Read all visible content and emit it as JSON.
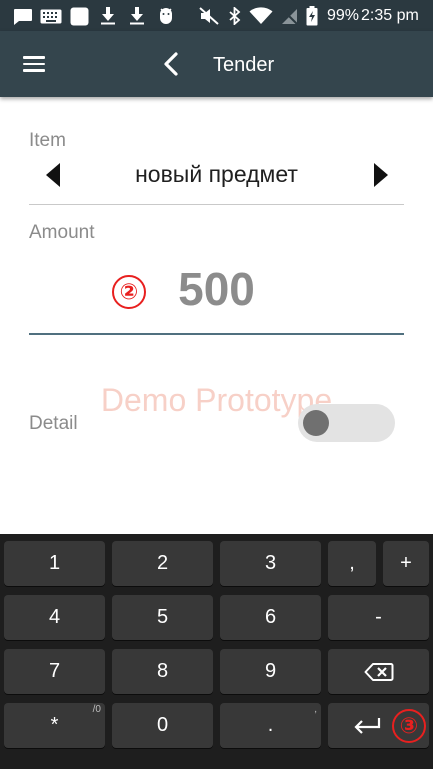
{
  "status_bar": {
    "battery": "99%",
    "time": "2:35 pm",
    "icons": [
      "message-icon",
      "keyboard-icon",
      "square-app-icon",
      "download-icon",
      "download-icon",
      "android-debug-icon",
      "mute-icon",
      "bluetooth-icon",
      "wifi-icon",
      "no-signal-icon",
      "battery-charging-icon"
    ]
  },
  "app_bar": {
    "title": "Tender",
    "menu_icon": "menu-icon",
    "back_icon": "back-chevron-icon"
  },
  "form": {
    "item_label": "Item",
    "item_value": "новый предмет",
    "amount_label": "Amount",
    "amount_value": "500",
    "detail_label": "Detail",
    "detail_toggle_on": false
  },
  "watermark": "Demo Prototype",
  "markers": {
    "amount": "②",
    "enter": "③"
  },
  "keyboard": {
    "rows": [
      [
        {
          "label": "1"
        },
        {
          "label": "2"
        },
        {
          "label": "3"
        },
        {
          "label": ","
        },
        {
          "label": "+"
        }
      ],
      [
        {
          "label": "4"
        },
        {
          "label": "5"
        },
        {
          "label": "6"
        },
        {
          "label": "-"
        }
      ],
      [
        {
          "label": "7"
        },
        {
          "label": "8"
        },
        {
          "label": "9"
        },
        {
          "label": "",
          "icon": "backspace-icon"
        }
      ],
      [
        {
          "label": "*",
          "hint": "/0"
        },
        {
          "label": "0"
        },
        {
          "label": ".",
          "hint": ","
        },
        {
          "label": "",
          "icon": "enter-icon"
        }
      ]
    ]
  },
  "colors": {
    "status_bar": "#2b3940",
    "app_bar": "#34454d",
    "keyboard_bg": "#1e1e1e",
    "key_bg": "#383838",
    "marker": "#e8201f"
  }
}
